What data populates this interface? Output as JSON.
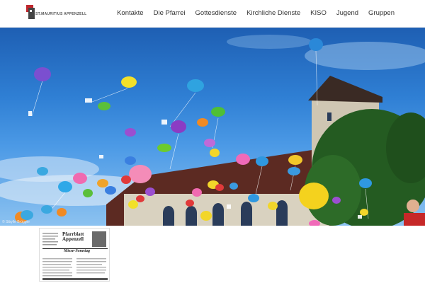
{
  "header": {
    "logo_text": "ST.MAURITIUS APPENZELL",
    "nav": [
      "Kontakte",
      "Die Pfarrei",
      "Gottesdienste",
      "Kirchliche Dienste",
      "KISO",
      "Jugend",
      "Gruppen"
    ]
  },
  "hero": {
    "photo_credit": "© Sibylle Brügger",
    "description_icon": "balloons-over-church-photo"
  },
  "thumbnail": {
    "title": "Pfarrblatt Appenzell",
    "subtitle": "Misse-Sonntag"
  },
  "colors": {
    "logo_red": "#c0272d",
    "logo_dark": "#444444",
    "nav_text": "#333333",
    "sky_top": "#1e5fb3",
    "sky_bottom": "#8cc2f0"
  }
}
